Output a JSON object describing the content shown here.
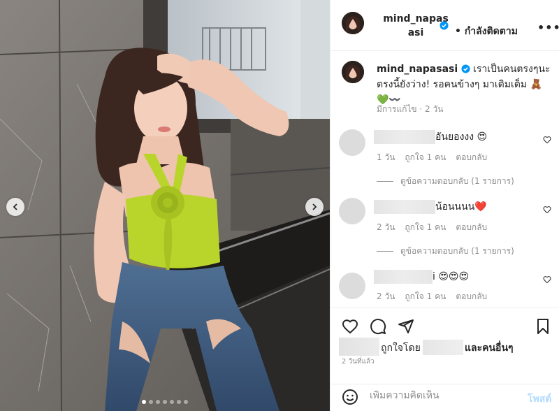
{
  "header": {
    "username_line1": "mind_napas",
    "username_line2": "asi",
    "follow_status": "• กำลังติดตาม",
    "more": "•••"
  },
  "caption": {
    "username": "mind_napasasi",
    "text": " เราเป็นคนตรงๆนะ ตรงนี้ยังว่าง! รอคนข้างๆ มาเติมเต็ม 🧸💚〰️",
    "meta": "มีการแก้ไข · 2 วัน"
  },
  "comments": [
    {
      "text": "อันยองงง 😍",
      "time": "1 วัน",
      "likes": "ถูกใจ 1 คน",
      "reply": "ตอบกลับ",
      "view_replies": "ดูข้อความตอบกลับ (1 รายการ)"
    },
    {
      "text": "น้อนนนน❤️",
      "time": "2 วัน",
      "likes": "ถูกใจ 1 คน",
      "reply": "ตอบกลับ",
      "view_replies": "ดูข้อความตอบกลับ (1 รายการ)"
    },
    {
      "text": "i 😍😍😍",
      "time": "2 วัน",
      "likes": "ถูกใจ 1 คน",
      "reply": "ตอบกลับ"
    }
  ],
  "likes": {
    "liked_by": "ถูกใจโดย",
    "and_others": "และคนอื่นๆ"
  },
  "timestamp": "2 วันที่แล้ว",
  "add_comment": {
    "placeholder": "เพิ่มความคิดเห็น",
    "post_label": "โพสต์"
  },
  "carousel": {
    "slide_count": 7,
    "active_index": 0
  },
  "colors": {
    "verified": "#0095f6",
    "heart_red": "#ed4956",
    "post_disabled": "#b3dbff",
    "text": "#262626",
    "muted": "#8e8e8e"
  }
}
